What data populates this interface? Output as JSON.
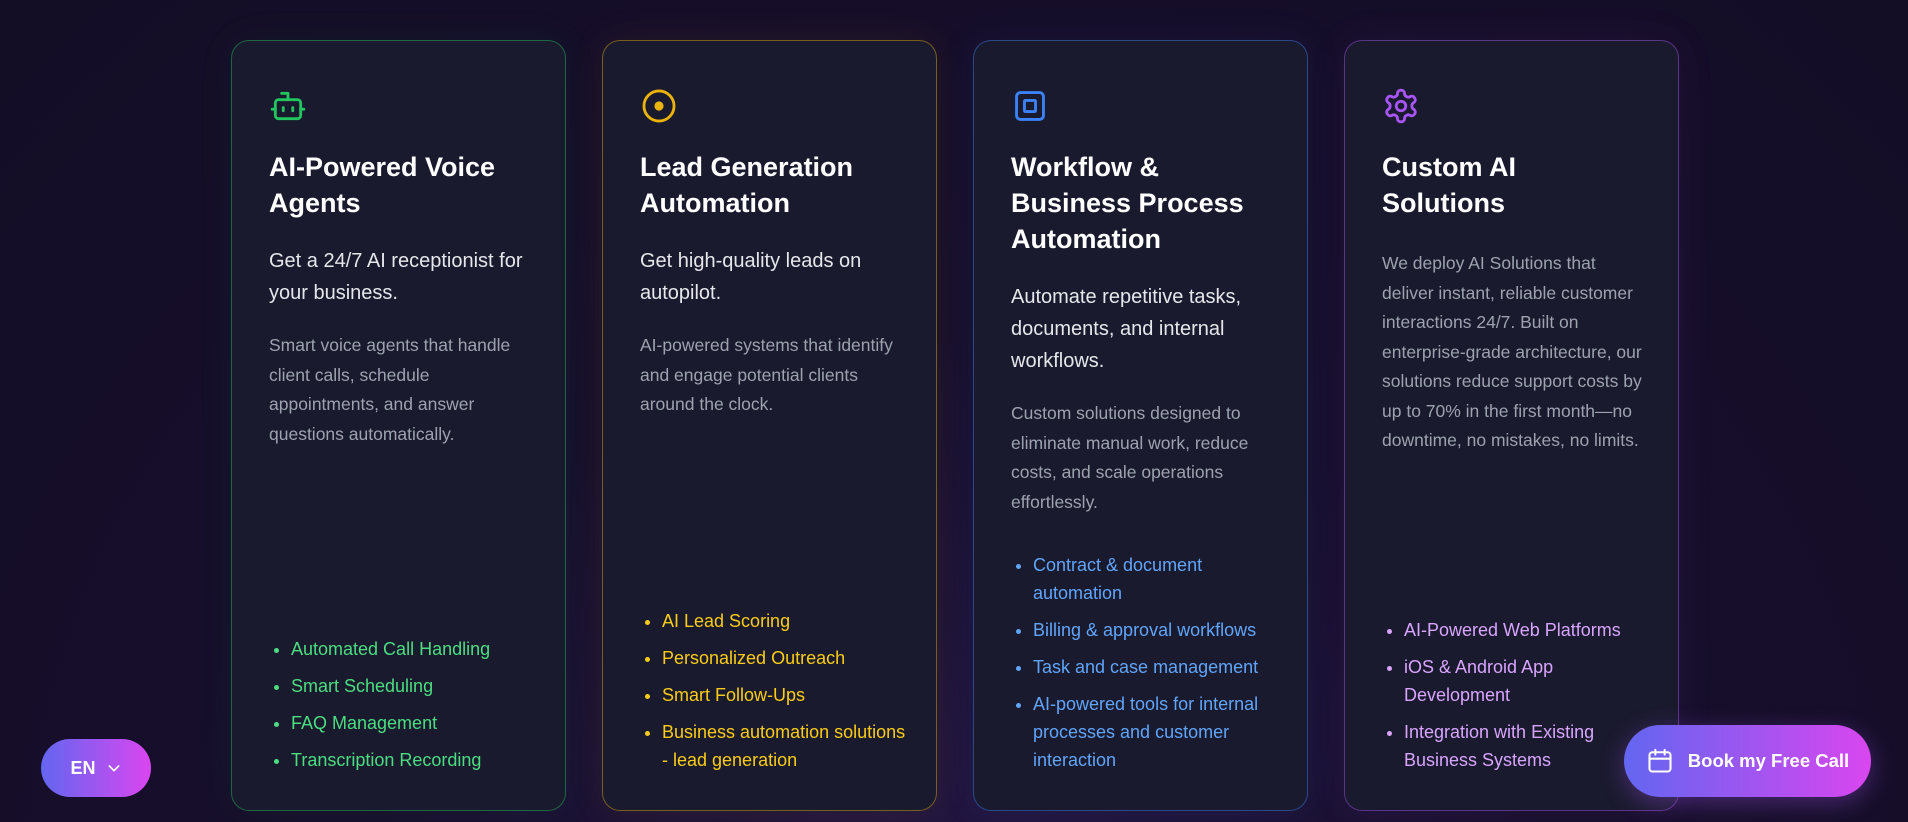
{
  "cards": [
    {
      "icon": "robot-icon",
      "accent": "#22c55e",
      "title": "AI-Powered Voice Agents",
      "subtitle": "Get a 24/7 AI receptionist for your business.",
      "description": "Smart voice agents that handle client calls, schedule appointments, and answer questions automatically.",
      "features": [
        "Automated Call Handling",
        "Smart Scheduling",
        "FAQ Management",
        "Transcription Recording"
      ]
    },
    {
      "icon": "target-icon",
      "accent": "#eab308",
      "title": "Lead Generation Automation",
      "subtitle": "Get high-quality leads on autopilot.",
      "description": "AI-powered systems that identify and engage potential clients around the clock.",
      "features": [
        "AI Lead Scoring",
        "Personalized Outreach",
        "Smart Follow-Ups",
        "Business automation solutions - lead generation"
      ]
    },
    {
      "icon": "chip-icon",
      "accent": "#3b82f6",
      "title": "Workflow & Business Process Automation",
      "subtitle": "Automate repetitive tasks, documents, and internal workflows.",
      "description": "Custom solutions designed to eliminate manual work, reduce costs, and scale operations effortlessly.",
      "features": [
        "Contract & document automation",
        "Billing & approval workflows",
        "Task and case management",
        "AI-powered tools for internal processes and customer interaction"
      ]
    },
    {
      "icon": "gear-icon",
      "accent": "#a855f7",
      "title": "Custom AI Solutions",
      "description": "We deploy AI Solutions that deliver instant, reliable customer interactions 24/7. Built on enterprise-grade architecture, our solutions reduce support costs by up to 70% in the first month—no downtime, no mistakes, no limits.",
      "features": [
        "AI-Powered Web Platforms",
        "iOS & Android App Development",
        "Integration with Existing Business Systems"
      ]
    }
  ],
  "language_button": {
    "label": "EN",
    "icon": "chevron-down-icon"
  },
  "cta_button": {
    "label": "Book my Free Call",
    "icon": "calendar-icon"
  },
  "colors": {
    "background": "#150e28",
    "card_background": "#1a1a2e",
    "gradient_start": "#6366f1",
    "gradient_end": "#d946ef"
  }
}
